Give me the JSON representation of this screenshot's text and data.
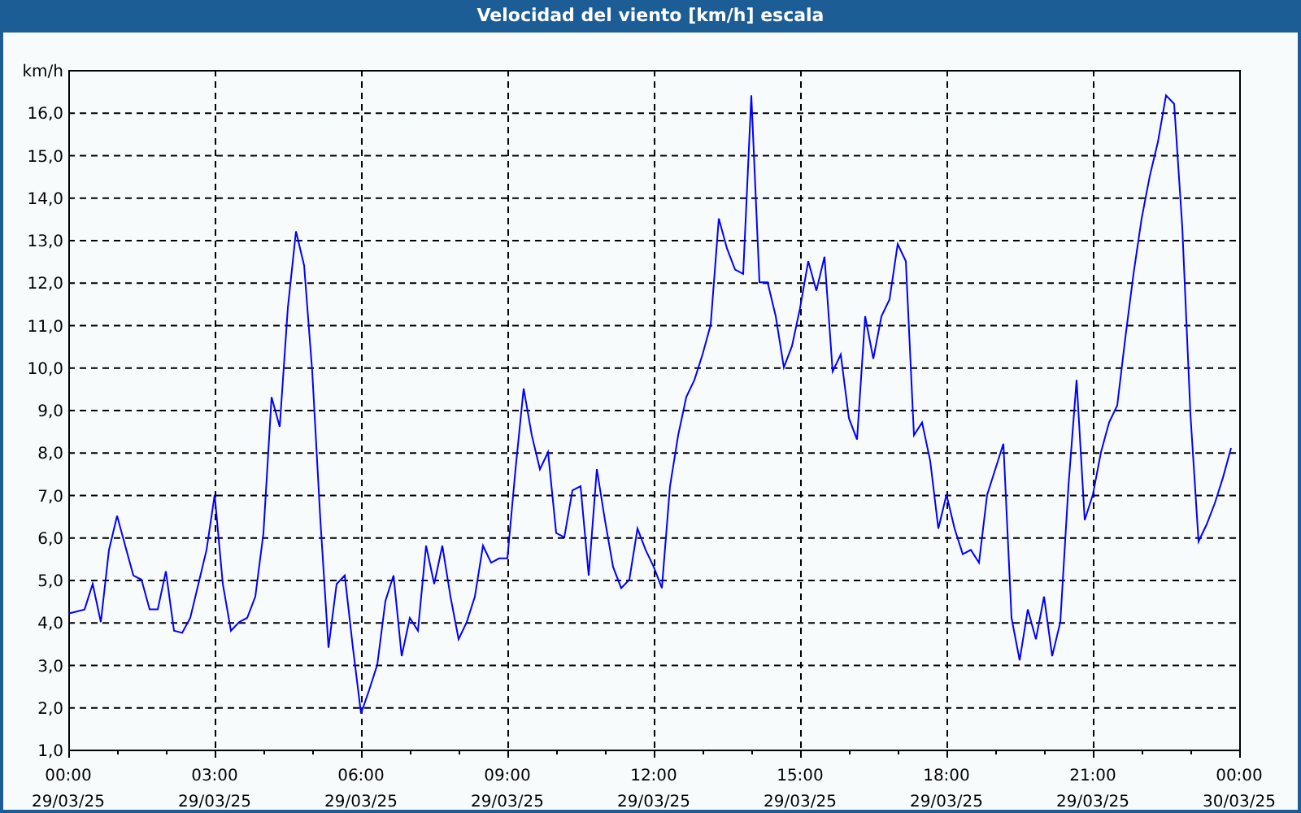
{
  "window": {
    "title": "Velocidad del viento [km/h] escala"
  },
  "chart": {
    "chart_data": {
      "type": "line",
      "grid": true,
      "ylabel": "km/h",
      "ylim": [
        1,
        17
      ],
      "yticks": [
        {
          "value": 1,
          "label": "1,0"
        },
        {
          "value": 2,
          "label": "2,0"
        },
        {
          "value": 3,
          "label": "3,0"
        },
        {
          "value": 4,
          "label": "4,0"
        },
        {
          "value": 5,
          "label": "5,0"
        },
        {
          "value": 6,
          "label": "6,0"
        },
        {
          "value": 7,
          "label": "7,0"
        },
        {
          "value": 8,
          "label": "8,0"
        },
        {
          "value": 9,
          "label": "9,0"
        },
        {
          "value": 10,
          "label": "10,0"
        },
        {
          "value": 11,
          "label": "11,0"
        },
        {
          "value": 12,
          "label": "12,0"
        },
        {
          "value": 13,
          "label": "13,0"
        },
        {
          "value": 14,
          "label": "14,0"
        },
        {
          "value": 15,
          "label": "15,0"
        },
        {
          "value": 16,
          "label": "16,0"
        }
      ],
      "categories": [
        "00:00 29/03/25",
        null,
        null,
        null,
        null,
        null,
        null,
        null,
        null,
        null,
        null,
        null,
        null,
        null,
        null,
        null,
        null,
        null,
        "03:00 29/03/25",
        null,
        null,
        null,
        null,
        null,
        null,
        null,
        null,
        null,
        null,
        null,
        null,
        null,
        null,
        null,
        null,
        null,
        "06:00 29/03/25",
        null,
        null,
        null,
        null,
        null,
        null,
        null,
        null,
        null,
        null,
        null,
        null,
        null,
        null,
        null,
        null,
        null,
        "09:00 29/03/25",
        null,
        null,
        null,
        null,
        null,
        null,
        null,
        null,
        null,
        null,
        null,
        null,
        null,
        null,
        null,
        null,
        null,
        "12:00 29/03/25",
        null,
        null,
        null,
        null,
        null,
        null,
        null,
        null,
        null,
        null,
        null,
        null,
        null,
        null,
        null,
        null,
        null,
        "15:00 29/03/25",
        null,
        null,
        null,
        null,
        null,
        null,
        null,
        null,
        null,
        null,
        null,
        null,
        null,
        null,
        null,
        null,
        null,
        "18:00 29/03/25",
        null,
        null,
        null,
        null,
        null,
        null,
        null,
        null,
        null,
        null,
        null,
        null,
        null,
        null,
        null,
        null,
        null,
        "21:00 29/03/25",
        null,
        null,
        null,
        null,
        null,
        null,
        null,
        null,
        null,
        null,
        null,
        null,
        null,
        null,
        null,
        null,
        null,
        "00:00 30/03/25"
      ],
      "series": [
        {
          "color": "#0000ff",
          "values": [
            4.2,
            4.25,
            4.3,
            4.9,
            4.0,
            5.7,
            6.5,
            5.8,
            5.1,
            5.0,
            4.3,
            4.3,
            5.2,
            3.8,
            3.75,
            4.1,
            4.9,
            5.7,
            7.0,
            4.9,
            3.8,
            4.0,
            4.1,
            4.6,
            6.1,
            9.3,
            8.6,
            11.4,
            13.2,
            12.4,
            9.9,
            6.4,
            3.4,
            4.9,
            5.1,
            3.4,
            1.85,
            2.4,
            3.0,
            4.5,
            5.1,
            3.2,
            4.1,
            3.8,
            5.8,
            4.9,
            5.8,
            4.6,
            3.6,
            4.0,
            4.6,
            5.8,
            5.4,
            5.5,
            5.5,
            7.6,
            9.5,
            8.4,
            7.6,
            8.0,
            6.1,
            6.0,
            7.1,
            7.2,
            5.1,
            7.6,
            6.4,
            5.3,
            4.8,
            5.0,
            6.2,
            5.7,
            5.3,
            4.8,
            7.2,
            8.4,
            9.3,
            9.7,
            10.3,
            11.0,
            13.5,
            12.8,
            12.3,
            12.2,
            16.4,
            12.0,
            12.0,
            11.2,
            10.0,
            10.5,
            11.4,
            12.5,
            11.8,
            12.6,
            9.9,
            10.3,
            8.8,
            8.3,
            11.2,
            10.2,
            11.2,
            11.6,
            12.9,
            12.5,
            8.4,
            8.7,
            7.8,
            6.2,
            7.0,
            6.2,
            5.6,
            5.7,
            5.4,
            7.0,
            7.6,
            8.2,
            4.1,
            3.1,
            4.3,
            3.6,
            4.6,
            3.2,
            4.0,
            7.2,
            9.7,
            6.4,
            7.0,
            8.0,
            8.7,
            9.1,
            10.7,
            12.2,
            13.5,
            14.5,
            15.3,
            16.4,
            16.2,
            13.3,
            8.9,
            5.9,
            6.3,
            6.8,
            7.4,
            8.1,
            null
          ]
        }
      ]
    }
  }
}
